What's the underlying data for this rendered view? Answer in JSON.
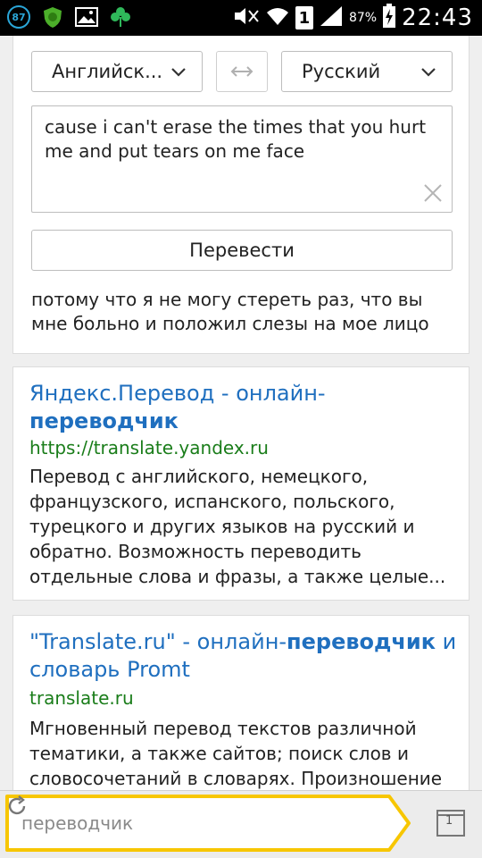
{
  "status_bar": {
    "notification_badge": "87",
    "sim_label": "1",
    "battery_text": "87%",
    "time": "22:43",
    "icons": [
      "notification-87-icon",
      "shield-icon",
      "gallery-icon",
      "clover-icon",
      "mute-icon",
      "wifi-icon",
      "sim-icon",
      "signal-icon",
      "battery-charging-icon"
    ]
  },
  "translator": {
    "source_lang": "Английск...",
    "target_lang": "Русский",
    "source_text": "cause i can't erase the times that you hurt me and put tears on me face",
    "translate_button": "Перевести",
    "result_text": "потому что я не могу стереть раз, что вы мне больно и положил слезы на мое лицо"
  },
  "results": [
    {
      "title_plain": "Яндекс.Перевод - онлайн-",
      "title_bold": "переводчик",
      "title_tail": "",
      "url": "https://translate.yandex.ru",
      "snippet": "Перевод с английского, немецкого, французского, испанского, польского, турецкого и других языков на русский и обратно. Возможность переводить отдельные слова и фразы, а также целые..."
    },
    {
      "title_plain": "\"Translate.ru\" - онлайн-",
      "title_bold": "переводчик",
      "title_tail": " и словарь Promt",
      "url": "translate.ru",
      "snippet": "Мгновенный перевод текстов различной тематики, а также сайтов; поиск слов и словосочетаний в словарях. Произношение"
    }
  ],
  "bottom_bar": {
    "search_query": "переводчик",
    "tab_count": "1"
  },
  "colors": {
    "link": "#1f6fbf",
    "url": "#1a7d1a",
    "search_border": "#f7c600"
  }
}
